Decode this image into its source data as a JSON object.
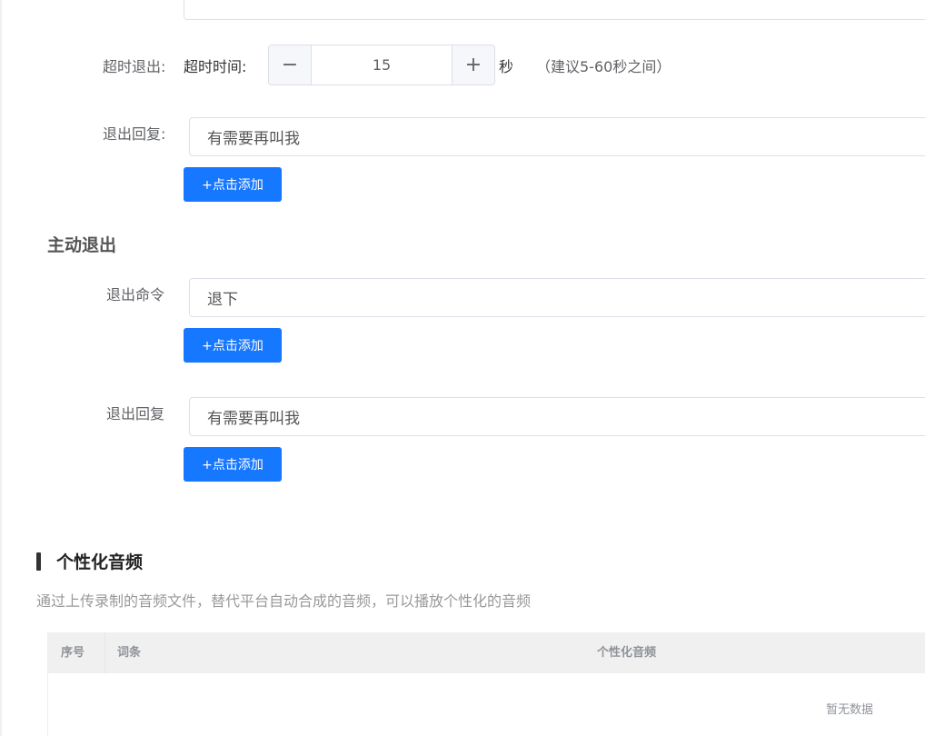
{
  "timeout_exit": {
    "label": "超时退出:",
    "time_label": "超时时间:",
    "minus_symbol": "−",
    "value": "15",
    "plus_symbol": "+",
    "unit": "秒",
    "hint": "（建议5-60秒之间）",
    "reply_label": "退出回复:",
    "reply_value": "有需要再叫我",
    "add_label": "+点击添加"
  },
  "active_exit": {
    "title": "主动退出",
    "command_label": "退出命令",
    "command_value": "退下",
    "command_add_label": "+点击添加",
    "reply_label": "退出回复",
    "reply_value": "有需要再叫我",
    "reply_add_label": "+点击添加"
  },
  "custom_audio": {
    "title": "个性化音频",
    "description": "通过上传录制的音频文件，替代平台自动合成的音频，可以播放个性化的音频",
    "columns": [
      "序号",
      "词条",
      "个性化音频"
    ],
    "empty_text": "暂无数据"
  },
  "colors": {
    "primary": "#1677ff",
    "border": "#dcdfe6",
    "table_header_bg": "#f0f0f0"
  }
}
